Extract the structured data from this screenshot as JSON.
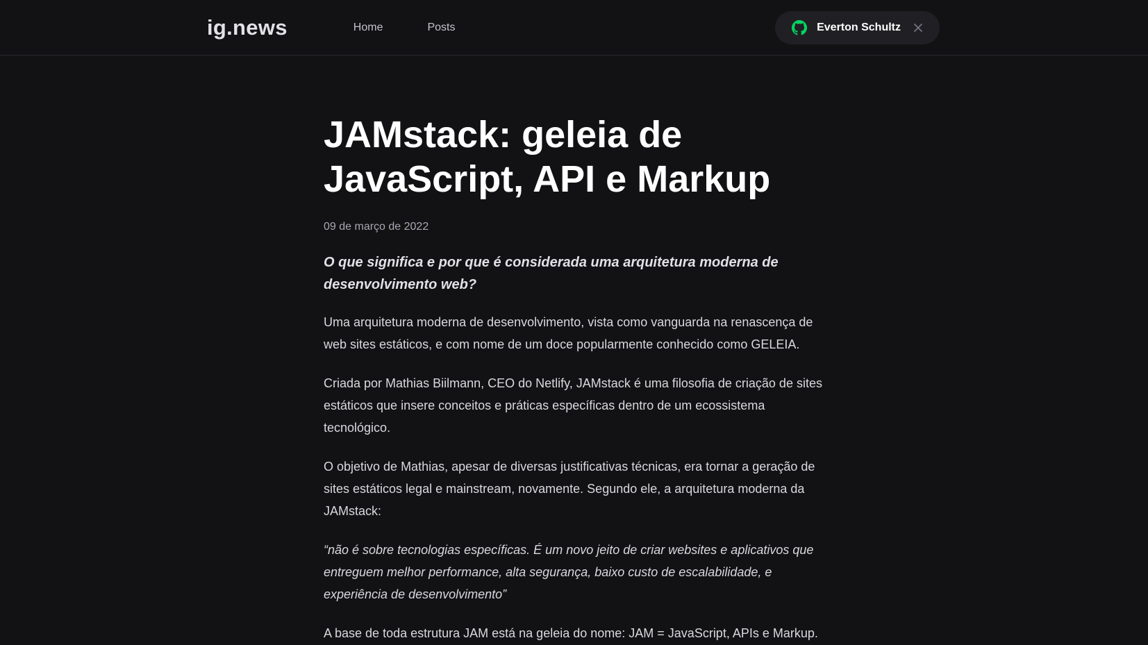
{
  "header": {
    "logo": "ig.news",
    "nav": [
      {
        "label": "Home"
      },
      {
        "label": "Posts"
      }
    ],
    "signin": {
      "user_name": "Everton Schultz",
      "icon": "github-icon",
      "close_icon": "close-icon",
      "accent": "#04d361"
    }
  },
  "post": {
    "title": "JAMstack: geleia de JavaScript, API e Markup",
    "date": "09 de março de 2022",
    "lead": "O que significa e por que é considerada uma arquitetura moderna de desenvolvimento web?",
    "paragraphs": [
      "Uma arquitetura moderna de desenvolvimento, vista como vanguarda na renascença de web sites estáticos, e com nome de um doce popularmente conhecido como GELEIA.",
      "Criada por Mathias Biilmann, CEO do Netlify, JAMstack é uma filosofia de criação de sites estáticos que insere conceitos e práticas específicas dentro de um ecossistema tecnológico.",
      "O objetivo de Mathias, apesar de diversas justificativas técnicas, era tornar a geração de sites estáticos legal e mainstream, novamente. Segundo ele, a arquitetura moderna da JAMstack:"
    ],
    "quote": "“não é sobre tecnologias específicas. É um novo jeito de criar websites e aplicativos que entreguem melhor performance, alta segurança, baixo custo de escalabilidade, e experiência de desenvolvimento”",
    "last_paragraph": "A base de toda estrutura JAM está na geleia do nome: JAM = JavaScript, APIs e Markup."
  }
}
